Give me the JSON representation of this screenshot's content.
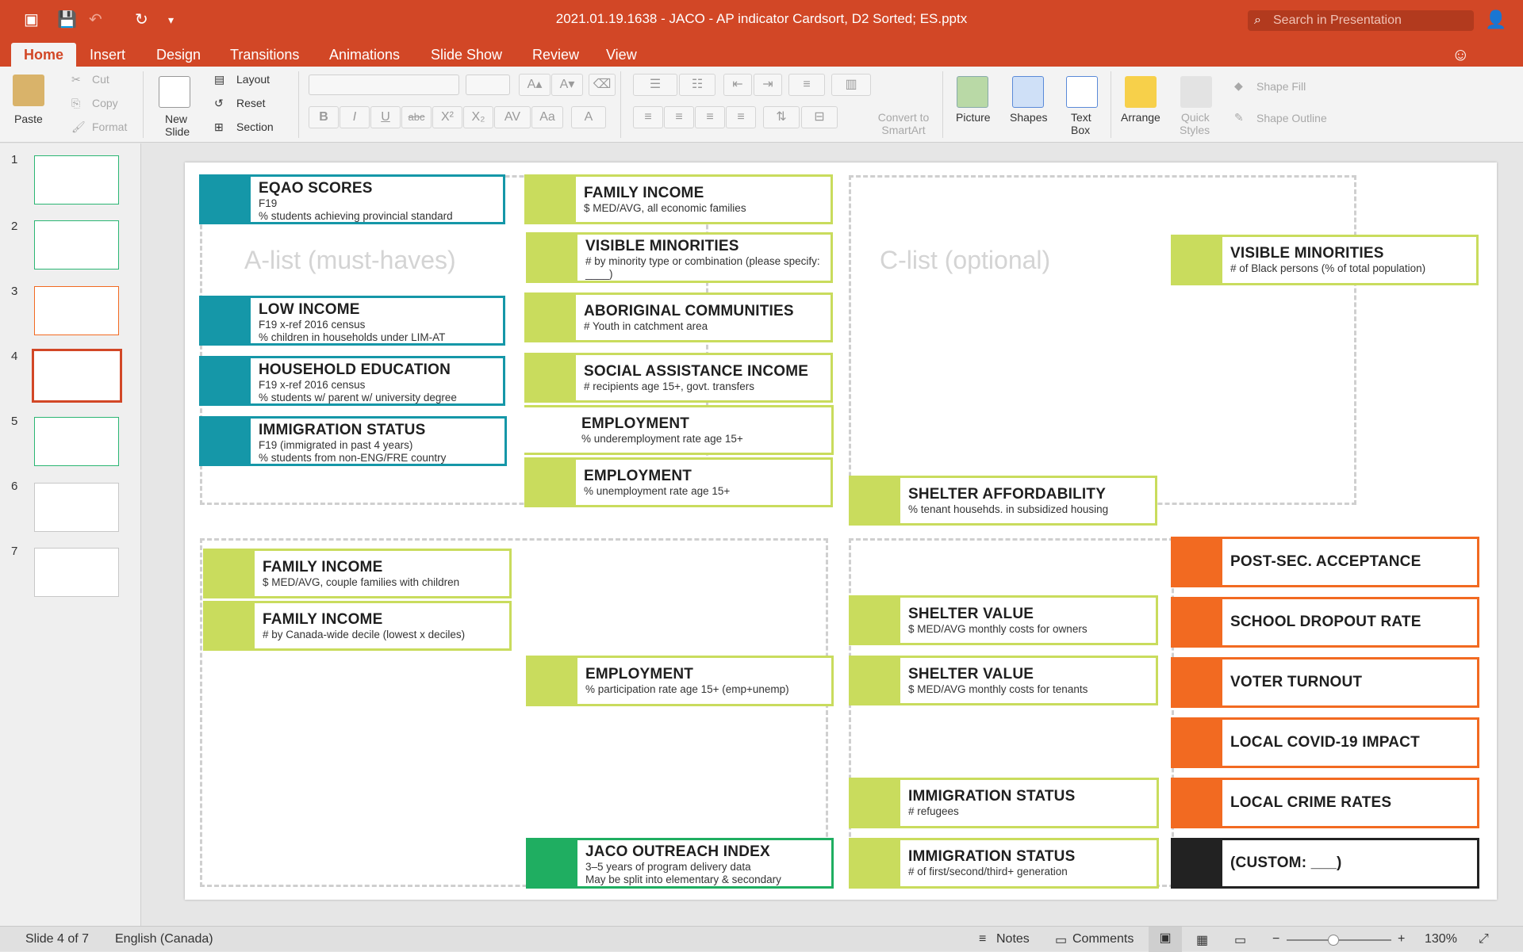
{
  "window": {
    "title": "2021.01.19.1638 - JACO - AP indicator Cardsort, D2 Sorted; ES.pptx",
    "search_placeholder": "Search in Presentation"
  },
  "tabs": [
    "Home",
    "Insert",
    "Design",
    "Transitions",
    "Animations",
    "Slide Show",
    "Review",
    "View"
  ],
  "ribbon": {
    "paste": "Paste",
    "cut": "Cut",
    "copy": "Copy",
    "format": "Format",
    "new_slide_1": "New",
    "new_slide_2": "Slide",
    "layout": "Layout",
    "reset": "Reset",
    "section": "Section",
    "convert_1": "Convert to",
    "convert_2": "SmartArt",
    "picture": "Picture",
    "shapes": "Shapes",
    "textbox_1": "Text",
    "textbox_2": "Box",
    "arrange": "Arrange",
    "quick_styles_1": "Quick",
    "quick_styles_2": "Styles",
    "shape_fill": "Shape Fill",
    "shape_outline": "Shape Outline",
    "bold": "B",
    "italic": "I",
    "underline": "U",
    "strike": "abc"
  },
  "thumbnails": [
    "1",
    "2",
    "3",
    "4",
    "5",
    "6",
    "7"
  ],
  "slide": {
    "hint_a": "A-list (must-haves)",
    "hint_c": "C-list (optional)",
    "cards": [
      {
        "title": "EQAO SCORES",
        "lines": [
          "F19",
          "% students achieving provincial standard"
        ]
      },
      {
        "title": "LOW INCOME",
        "lines": [
          "F19 x-ref 2016 census",
          "% children in households under LIM-AT"
        ]
      },
      {
        "title": "HOUSEHOLD EDUCATION",
        "lines": [
          "F19 x-ref 2016 census",
          "% students w/ parent w/ university degree"
        ]
      },
      {
        "title": "IMMIGRATION STATUS",
        "lines": [
          "F19 (immigrated in past 4 years)",
          "% students from non-ENG/FRE country"
        ]
      },
      {
        "title": "FAMILY INCOME",
        "lines": [
          "$ MED/AVG, all economic families"
        ]
      },
      {
        "title": "VISIBLE MINORITIES",
        "lines": [
          "# by minority type or combination (please specify: ____)"
        ]
      },
      {
        "title": "ABORIGINAL COMMUNITIES",
        "lines": [
          "# Youth in catchment area"
        ]
      },
      {
        "title": "SOCIAL ASSISTANCE INCOME",
        "lines": [
          "# recipients age 15+, govt. transfers"
        ]
      },
      {
        "title": "EMPLOYMENT",
        "lines": [
          "% underemployment rate age 15+"
        ]
      },
      {
        "title": "EMPLOYMENT",
        "lines": [
          "% unemployment rate age 15+"
        ]
      },
      {
        "title": "VISIBLE MINORITIES",
        "lines": [
          "# of Black persons (% of total population)"
        ]
      },
      {
        "title": "SHELTER AFFORDABILITY",
        "lines": [
          "% tenant househds. in subsidized housing"
        ]
      },
      {
        "title": "FAMILY INCOME",
        "lines": [
          "$ MED/AVG, couple families with children"
        ]
      },
      {
        "title": "FAMILY INCOME",
        "lines": [
          "# by Canada-wide decile (lowest x deciles)"
        ]
      },
      {
        "title": "EMPLOYMENT",
        "lines": [
          "% participation rate age 15+ (emp+unemp)"
        ]
      },
      {
        "title": "JACO OUTREACH INDEX",
        "lines": [
          "3–5 years of program delivery data",
          "May be split into elementary & secondary"
        ]
      },
      {
        "title": "SHELTER VALUE",
        "lines": [
          "$ MED/AVG monthly costs for owners"
        ]
      },
      {
        "title": "SHELTER VALUE",
        "lines": [
          "$ MED/AVG monthly costs for tenants"
        ]
      },
      {
        "title": "IMMIGRATION STATUS",
        "lines": [
          "# refugees"
        ]
      },
      {
        "title": "IMMIGRATION STATUS",
        "lines": [
          "# of first/second/third+ generation"
        ]
      },
      {
        "title": "POST-SEC. ACCEPTANCE",
        "lines": []
      },
      {
        "title": "SCHOOL DROPOUT RATE",
        "lines": []
      },
      {
        "title": "VOTER TURNOUT",
        "lines": []
      },
      {
        "title": "LOCAL COVID-19 IMPACT",
        "lines": []
      },
      {
        "title": "LOCAL CRIME RATES",
        "lines": []
      },
      {
        "title": "(CUSTOM: ___)",
        "lines": []
      }
    ]
  },
  "status": {
    "slide": "Slide 4 of 7",
    "language": "English (Canada)",
    "notes": "Notes",
    "comments": "Comments",
    "zoom": "130%",
    "zoom_fraction": 0.45
  },
  "colors": {
    "accent": "#d24726",
    "teal": "#1597a8",
    "lime": "#c9dc5d",
    "orange": "#f26a21",
    "green": "#1fae61",
    "black": "#222222"
  }
}
